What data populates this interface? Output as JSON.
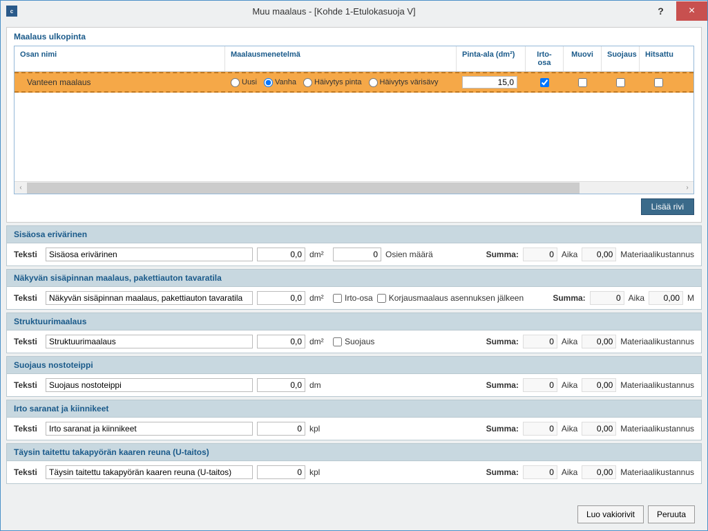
{
  "window": {
    "title": "Muu maalaus - [Kohde 1-Etulokasuoja V]",
    "help": "?",
    "close": "×"
  },
  "ulkopinta": {
    "title": "Maalaus ulkopinta",
    "headers": {
      "name": "Osan nimi",
      "method": "Maalausmenetelmä",
      "area": "Pinta-ala (dm²)",
      "irto": "Irto-osa",
      "muovi": "Muovi",
      "suojaus": "Suojaus",
      "hitsattu": "Hitsattu"
    },
    "row": {
      "name": "Vanteen maalaus",
      "radios": {
        "uusi": "Uusi",
        "vanha": "Vanha",
        "haivytys_pinta": "Häivytys pinta",
        "haivytys_sarisavy": "Häivytys värisävy"
      },
      "area": "15,0"
    },
    "add_row": "Lisää rivi"
  },
  "sections": [
    {
      "title": "Sisäosa erivärinen",
      "teksti_label": "Teksti",
      "teksti": "Sisäosa erivärinen",
      "val": "0,0",
      "unit": "dm²",
      "val2": "0",
      "val2_label": "Osien määrä",
      "summa_label": "Summa:",
      "summa": "0",
      "aika_label": "Aika",
      "aika": "0,00",
      "mat_label": "Materiaalikustannus"
    },
    {
      "title": "Näkyvän sisäpinnan maalaus, pakettiauton tavaratila",
      "teksti_label": "Teksti",
      "teksti": "Näkyvän sisäpinnan maalaus, pakettiauton tavaratila",
      "val": "0,0",
      "unit": "dm²",
      "chk1": "Irto-osa",
      "chk2": "Korjausmaalaus asennuksen jälkeen",
      "summa_label": "Summa:",
      "summa": "0",
      "aika_label": "Aika",
      "aika": "0,00",
      "extra": "M"
    },
    {
      "title": "Struktuurimaalaus",
      "teksti_label": "Teksti",
      "teksti": "Struktuurimaalaus",
      "val": "0,0",
      "unit": "dm²",
      "chk1": "Suojaus",
      "summa_label": "Summa:",
      "summa": "0",
      "aika_label": "Aika",
      "aika": "0,00",
      "mat_label": "Materiaalikustannus"
    },
    {
      "title": "Suojaus nostoteippi",
      "teksti_label": "Teksti",
      "teksti": "Suojaus nostoteippi",
      "val": "0,0",
      "unit": "dm",
      "summa_label": "Summa:",
      "summa": "0",
      "aika_label": "Aika",
      "aika": "0,00",
      "mat_label": "Materiaalikustannus"
    },
    {
      "title": "Irto saranat ja kiinnikeet",
      "teksti_label": "Teksti",
      "teksti": "Irto saranat ja kiinnikeet",
      "val": "0",
      "unit": "kpl",
      "summa_label": "Summa:",
      "summa": "0",
      "aika_label": "Aika",
      "aika": "0,00",
      "mat_label": "Materiaalikustannus"
    },
    {
      "title": "Täysin taitettu takapyörän kaaren reuna (U-taitos)",
      "teksti_label": "Teksti",
      "teksti": "Täysin taitettu takapyörän kaaren reuna (U-taitos)",
      "val": "0",
      "unit": "kpl",
      "summa_label": "Summa:",
      "summa": "0",
      "aika_label": "Aika",
      "aika": "0,00",
      "mat_label": "Materiaalikustannus"
    }
  ],
  "footer": {
    "luo": "Luo vakiorivit",
    "peruuta": "Peruuta"
  }
}
